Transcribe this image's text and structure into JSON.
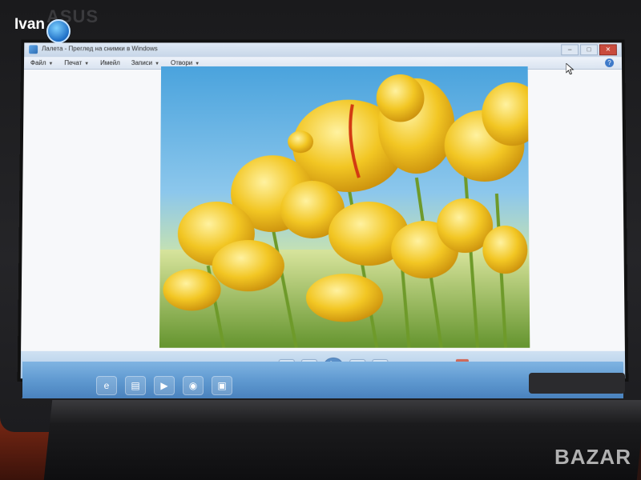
{
  "overlay": {
    "user_label": "Ivan",
    "brand_logo": "ASUS",
    "watermark": "BAZAR"
  },
  "window": {
    "title": "Лалета - Преглед на снимки в Windows",
    "buttons": {
      "minimize": "–",
      "maximize": "□",
      "close": "✕"
    },
    "menu": [
      {
        "label": "Файл"
      },
      {
        "label": "Печат"
      },
      {
        "label": "Имейл"
      },
      {
        "label": "Записи"
      },
      {
        "label": "Отвори"
      }
    ],
    "help_glyph": "?"
  },
  "photo": {
    "subject": "yellow-tulips",
    "colors": {
      "sky": "#4aa3dd",
      "petal": "#f2c623",
      "stem": "#6e9a2a",
      "stripe": "#d23a12"
    }
  },
  "viewer_controls": {
    "prev_glyph": "⏮",
    "play_glyph": "▶",
    "next_glyph": "⏭",
    "rotate_left_glyph": "↺",
    "rotate_right_glyph": "↻",
    "delete_glyph": "✕"
  },
  "taskbar": {
    "icons": [
      {
        "name": "ie-icon",
        "glyph": "e"
      },
      {
        "name": "explorer-icon",
        "glyph": "▤"
      },
      {
        "name": "media-player-icon",
        "glyph": "▶"
      },
      {
        "name": "chrome-icon",
        "glyph": "◉"
      },
      {
        "name": "photo-viewer-icon",
        "glyph": "▣"
      }
    ],
    "accent": "#5d97cf"
  }
}
